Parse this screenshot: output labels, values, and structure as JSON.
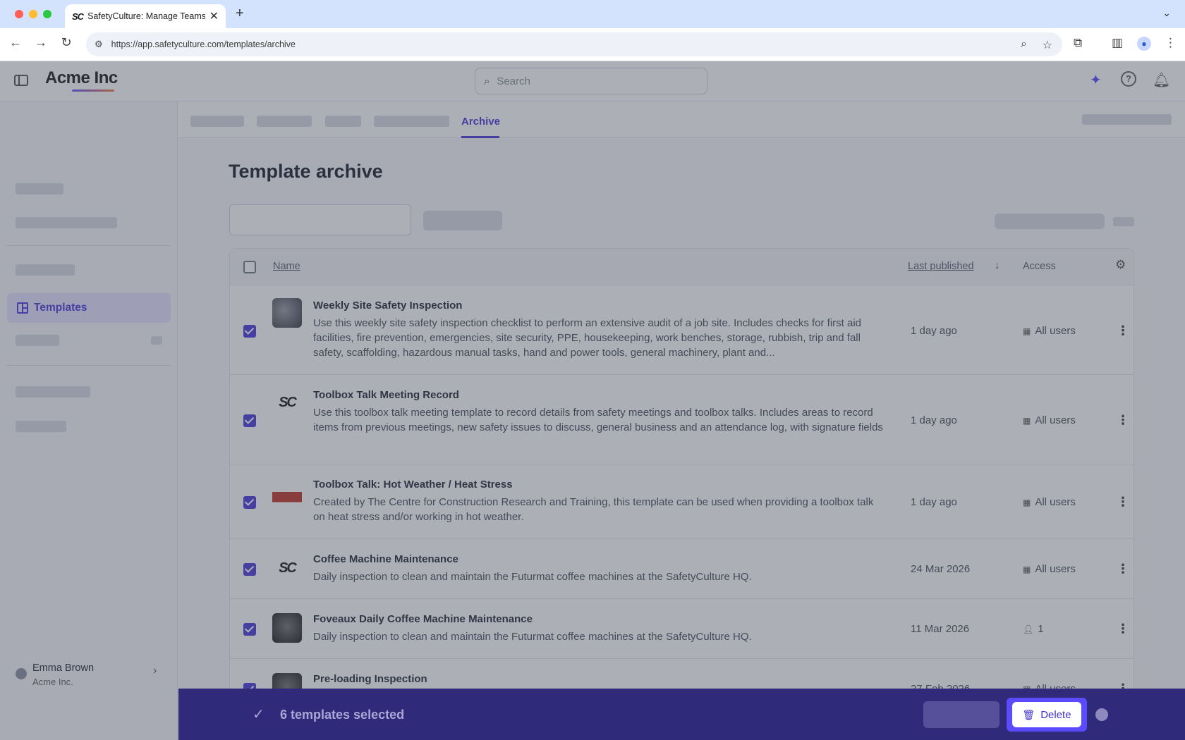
{
  "browser": {
    "tab_title": "SafetyCulture: Manage Teams and...",
    "favicon_text": "SC",
    "url": "https://app.safetyculture.com/templates/archive"
  },
  "header": {
    "logo": "Acme Inc",
    "search_placeholder": "Search"
  },
  "sidebar": {
    "active_item": "Templates",
    "user_name": "Emma Brown",
    "user_org": "Acme Inc."
  },
  "subnav": {
    "active_tab": "Archive"
  },
  "page": {
    "title": "Template archive"
  },
  "table": {
    "columns": {
      "name": "Name",
      "last_published": "Last published",
      "access": "Access"
    },
    "rows": [
      {
        "title": "Weekly Site Safety Inspection",
        "description": "Use this weekly site safety inspection checklist to perform an extensive audit of a job site. Includes checks for first aid facilities, fire prevention, emergencies, site security, PPE, housekeeping, work benches, storage, rubbish, trip and fall safety, scaffolding, hazardous manual tasks, hand and power tools, general machinery, plant and...",
        "date": "1 day ago",
        "access": "All users",
        "thumb": "photo"
      },
      {
        "title": "Toolbox Talk Meeting Record",
        "description": "Use this toolbox talk meeting template to record details from safety meetings and toolbox talks. Includes areas to record items from previous meetings, new safety issues to discuss, general business and an attendance log, with signature fields",
        "date": "1 day ago",
        "access": "All users",
        "thumb": "sc"
      },
      {
        "title": "Toolbox Talk: Hot Weather / Heat Stress",
        "description": "Created by The Centre for Construction Research and Training, this template can be used when providing a toolbox talk on heat stress and/or working in hot weather.",
        "date": "1 day ago",
        "access": "All users",
        "thumb": "red"
      },
      {
        "title": "Coffee Machine Maintenance",
        "description": "Daily inspection to clean and maintain the Futurmat coffee machines at the SafetyCulture HQ.",
        "date": "24 Mar 2026",
        "access": "All users",
        "thumb": "sc"
      },
      {
        "title": "Foveaux Daily Coffee Machine Maintenance",
        "description": "Daily inspection to clean and maintain the Futurmat coffee machines at the SafetyCulture HQ.",
        "date": "11 Mar 2026",
        "access": "1",
        "thumb": "dark"
      },
      {
        "title": "Pre-loading Inspection",
        "description": "",
        "date": "27 Feb 2026",
        "access": "All users",
        "thumb": "dark"
      }
    ]
  },
  "bulk": {
    "selected_text": "6 templates selected",
    "delete_label": "Delete"
  },
  "colors": {
    "accent": "#4b3fd9",
    "bulkbar": "#302a7a",
    "highlight": "#5b4bff"
  }
}
